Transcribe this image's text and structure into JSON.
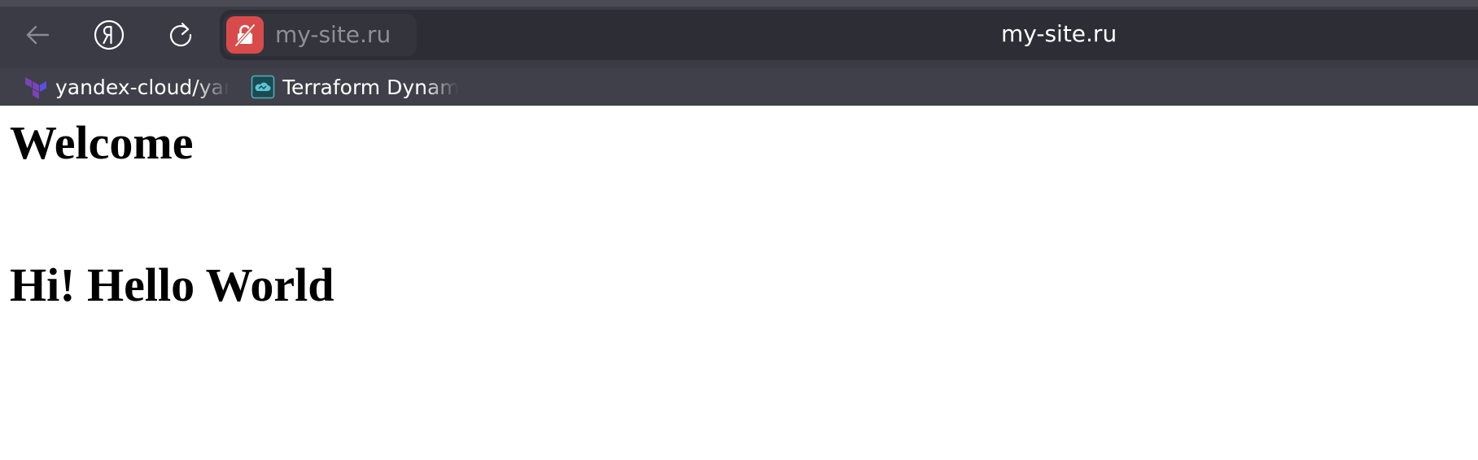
{
  "browser": {
    "address_url": "my-site.ru",
    "site_chip_label": "my-site.ru",
    "icons": {
      "back": "arrow-left-icon",
      "yandex": "yandex-logo-icon",
      "reload": "reload-icon",
      "lock": "insecure-lock-icon"
    },
    "colors": {
      "chrome": "#3a3b45",
      "address_bg": "#2c2d35",
      "insecure_badge": "#d94b4b"
    }
  },
  "bookmarks": [
    {
      "label": "yandex-cloud/yandex",
      "icon": "terraform-icon"
    },
    {
      "label": "Terraform Dynamic",
      "icon": "cloud-icon"
    }
  ],
  "page": {
    "heading_1": "Welcome",
    "heading_2": "Hi! Hello World"
  }
}
